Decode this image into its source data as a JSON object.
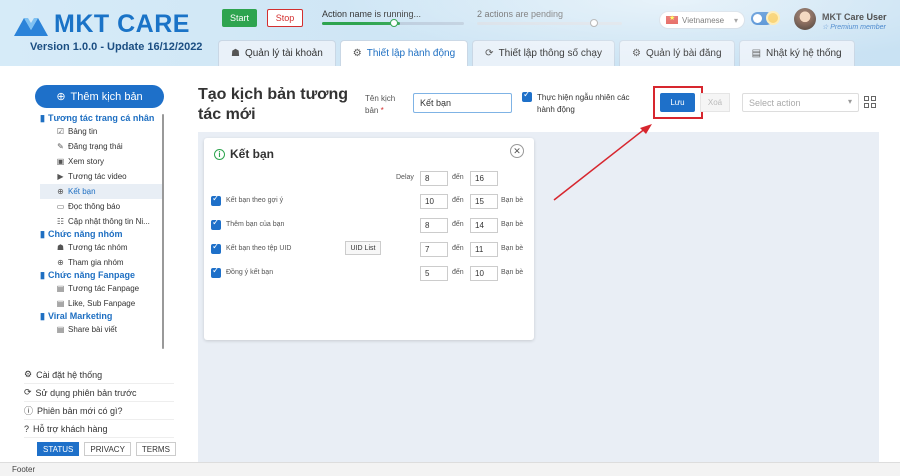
{
  "app": {
    "logo_text": "MKT CARE",
    "version": "Version 1.0.0 - Update 16/12/2022"
  },
  "controls": {
    "start": "Start",
    "stop": "Stop",
    "action_status": "Action name is running...",
    "pending_status": "2 actions are pending",
    "progress_running": 0.55,
    "progress_pending": 0.65
  },
  "header": {
    "language": "Vietnamese",
    "user_name": "MKT Care User",
    "user_tier": "☆ Premium member",
    "dark_mode": true
  },
  "tabs": [
    {
      "label": "Quản lý tài khoản",
      "icon": "users-icon"
    },
    {
      "label": "Thiết lập hành động",
      "icon": "gear-icon",
      "active": true
    },
    {
      "label": "Thiết lập thông số chạy",
      "icon": "refresh-icon"
    },
    {
      "label": "Quản lý bài đăng",
      "icon": "gear-icon"
    },
    {
      "label": "Nhật ký hệ thống",
      "icon": "log-icon"
    }
  ],
  "sidebar": {
    "add_button": "Thêm kịch bản",
    "groups": [
      {
        "title": "Tương tác trang cá nhân",
        "items": [
          "Bảng tin",
          "Đăng trạng thái",
          "Xem story",
          "Tương tác video",
          "Kết bạn",
          "Đọc thông báo",
          "Cập nhật thông tin Ni..."
        ]
      },
      {
        "title": "Chức năng nhóm",
        "items": [
          "Tương tác nhóm",
          "Tham gia nhóm"
        ]
      },
      {
        "title": "Chức năng Fanpage",
        "items": [
          "Tương tác Fanpage",
          "Like, Sub Fanpage"
        ]
      },
      {
        "title": "Viral Marketing",
        "items": [
          "Share bài viết"
        ]
      }
    ],
    "selected_item": "Kết bạn",
    "links": [
      "Cài đặt hệ thống",
      "Sử dụng phiên bản trước",
      "Phiên bản mới có gì?",
      "Hỗ trợ khách hàng"
    ],
    "chips": [
      "STATUS",
      "PRIVACY",
      "TERMS"
    ]
  },
  "main": {
    "title": "Tạo kịch bản tương tác mới",
    "name_label": "Tên kịch bản",
    "name_value": "Kết bạn",
    "random_label": "Thực hiện ngẫu nhiên các hành động",
    "save": "Lưu",
    "delete": "Xoá",
    "select_placeholder": "Select action"
  },
  "card": {
    "title": "Kết bạn",
    "delay_label": "Delay",
    "delay_from": "8",
    "to_label": "đến",
    "delay_to": "16",
    "unit": "Bạn bè",
    "uid_button": "UID List",
    "rows": [
      {
        "label": "Kết bạn theo gợi ý",
        "from": "10",
        "to": "15"
      },
      {
        "label": "Thêm bạn của bạn",
        "from": "8",
        "to": "14"
      },
      {
        "label": "Kết bạn theo tệp UID",
        "from": "7",
        "to": "11"
      },
      {
        "label": "Đồng ý kết bạn",
        "from": "5",
        "to": "10"
      }
    ]
  },
  "footer": {
    "text": "Footer"
  }
}
